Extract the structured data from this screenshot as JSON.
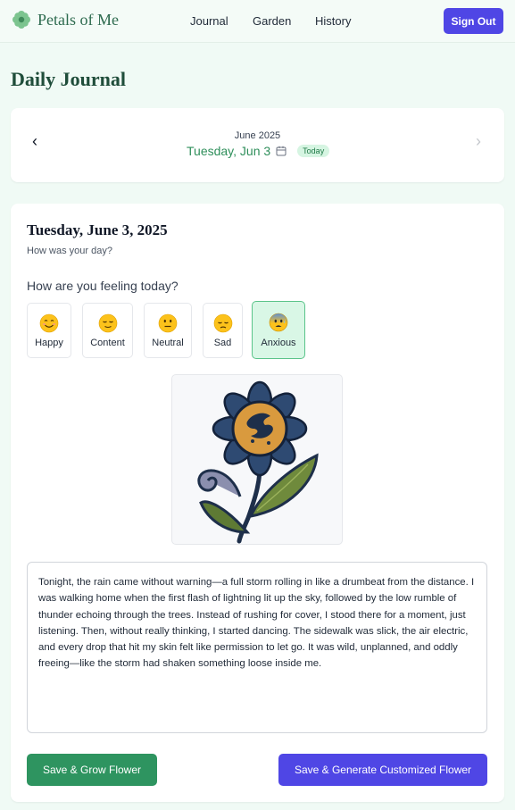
{
  "brand": {
    "name": "Petals of Me",
    "icon": "flower-logo-icon"
  },
  "nav": {
    "items": [
      "Journal",
      "Garden",
      "History"
    ],
    "sign_out": "Sign Out"
  },
  "page": {
    "title": "Daily Journal"
  },
  "date_nav": {
    "month": "June 2025",
    "selected": "Tuesday, Jun 3",
    "today_badge": "Today",
    "prev_icon": "chevron-left-icon",
    "next_icon": "chevron-right-icon",
    "calendar_icon": "calendar-icon"
  },
  "entry": {
    "date": "Tuesday, June 3, 2025",
    "subtitle": "How was your day?",
    "feeling_question": "How are you feeling today?",
    "moods": [
      {
        "label": "Happy",
        "icon": "smiling-face-icon"
      },
      {
        "label": "Content",
        "icon": "relieved-face-icon"
      },
      {
        "label": "Neutral",
        "icon": "neutral-face-icon"
      },
      {
        "label": "Sad",
        "icon": "pensive-face-icon"
      },
      {
        "label": "Anxious",
        "icon": "anxious-face-icon"
      }
    ],
    "selected_mood": "Anxious",
    "flower_image": "embroidered-flower-image",
    "journal_text": "Tonight, the rain came without warning—a full storm rolling in like a drumbeat from the distance. I was walking home when the first flash of lightning lit up the sky, followed by the low rumble of thunder echoing through the trees. Instead of rushing for cover, I stood there for a moment, just listening. Then, without really thinking, I started dancing. The sidewalk was slick, the air electric, and every drop that hit my skin felt like permission to let go. It was wild, unplanned, and oddly freeing—like the storm had shaken something loose inside me."
  },
  "actions": {
    "save_grow": "Save & Grow Flower",
    "save_generate": "Save & Generate Customized Flower"
  },
  "colors": {
    "primary": "#4f46e5",
    "green": "#2e9460",
    "brand_green": "#2e6b4f",
    "background": "#f0faf5",
    "mood_selected_bg": "#d9f7e6"
  }
}
